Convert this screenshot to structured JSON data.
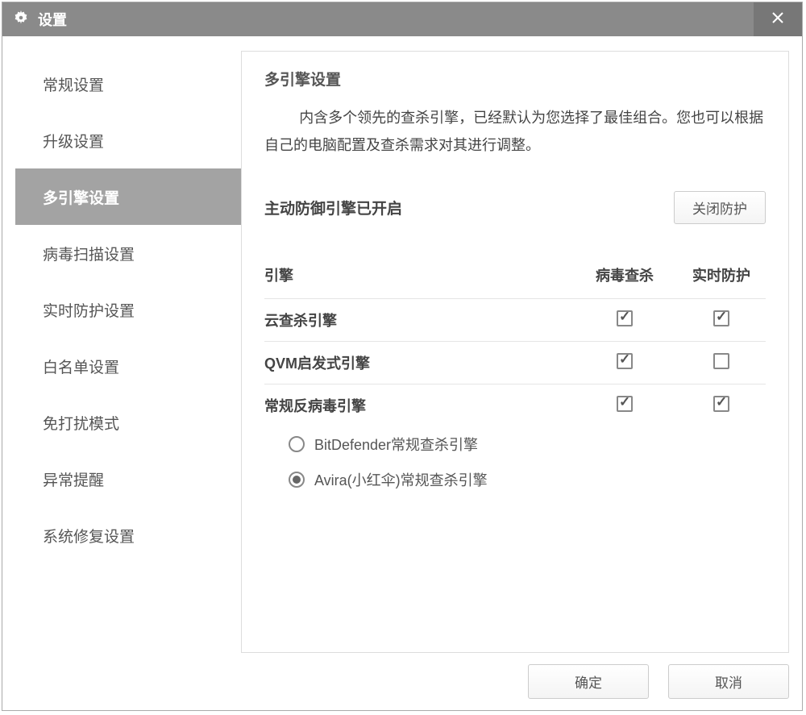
{
  "window": {
    "title": "设置"
  },
  "sidebar": {
    "items": [
      {
        "label": "常规设置",
        "active": false
      },
      {
        "label": "升级设置",
        "active": false
      },
      {
        "label": "多引擎设置",
        "active": true
      },
      {
        "label": "病毒扫描设置",
        "active": false
      },
      {
        "label": "实时防护设置",
        "active": false
      },
      {
        "label": "白名单设置",
        "active": false
      },
      {
        "label": "免打扰模式",
        "active": false
      },
      {
        "label": "异常提醒",
        "active": false
      },
      {
        "label": "系统修复设置",
        "active": false
      }
    ]
  },
  "content": {
    "section_title": "多引擎设置",
    "description": "内含多个领先的查杀引擎，已经默认为您选择了最佳组合。您也可以根据自己的电脑配置及查杀需求对其进行调整。",
    "defense_status": "主动防御引擎已开启",
    "toggle_button": "关闭防护",
    "table": {
      "col_engine": "引擎",
      "col_scan": "病毒查杀",
      "col_realtime": "实时防护",
      "rows": [
        {
          "label": "云查杀引擎",
          "scan": true,
          "realtime": true
        },
        {
          "label": "QVM启发式引擎",
          "scan": true,
          "realtime": false
        },
        {
          "label": "常规反病毒引擎",
          "scan": true,
          "realtime": true
        }
      ],
      "radios": [
        {
          "label": "BitDefender常规查杀引擎",
          "selected": false
        },
        {
          "label": "Avira(小红伞)常规查杀引擎",
          "selected": true
        }
      ]
    }
  },
  "footer": {
    "ok": "确定",
    "cancel": "取消"
  }
}
